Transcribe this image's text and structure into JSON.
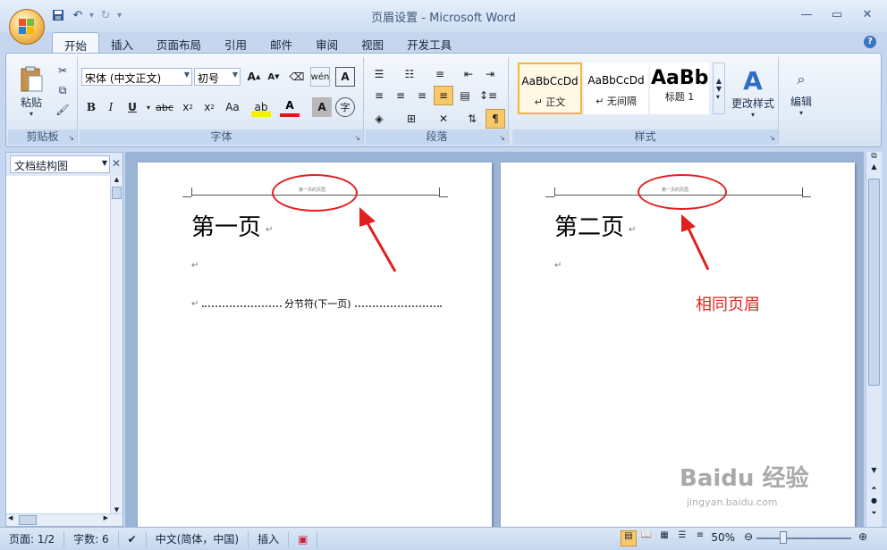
{
  "window": {
    "title": "页眉设置 - Microsoft Word"
  },
  "qat": {
    "save": "save-icon",
    "undo": "undo-icon",
    "redo": "redo-icon",
    "customize": "▾"
  },
  "tabs": [
    "开始",
    "插入",
    "页面布局",
    "引用",
    "邮件",
    "审阅",
    "视图",
    "开发工具"
  ],
  "ribbon": {
    "clipboard": {
      "paste_label": "粘贴",
      "group_label": "剪贴板"
    },
    "font": {
      "font_name": "宋体 (中文正文)",
      "font_size": "初号",
      "group_label": "字体"
    },
    "paragraph": {
      "group_label": "段落"
    },
    "styles": {
      "group_label": "样式",
      "items": [
        {
          "sample": "AaBbCcDd",
          "name": "↵ 正文"
        },
        {
          "sample": "AaBbCcDd",
          "name": "↵ 无间隔"
        },
        {
          "sample": "AaBb",
          "name": "标题 1"
        }
      ],
      "change_styles": "更改样式"
    },
    "editing": {
      "label": "编辑"
    }
  },
  "nav_pane": {
    "selected": "文档结构图"
  },
  "document": {
    "page1": {
      "header_text": "第一页的页眉",
      "heading": "第一页",
      "section_break": "分节符(下一页)"
    },
    "page2": {
      "header_text": "第一页的页眉",
      "heading": "第二页",
      "annotation": "相同页眉"
    }
  },
  "statusbar": {
    "page": "页面: 1/2",
    "words": "字数: 6",
    "language": "中文(简体，中国)",
    "mode": "插入",
    "zoom": "50%"
  },
  "watermark": {
    "brand": "Baidu 经验",
    "url": "jingyan.baidu.com"
  },
  "colors": {
    "annotation": "#e21f1f",
    "ribbon_bg": "#dfe9f7",
    "accent": "#f5b53d"
  }
}
